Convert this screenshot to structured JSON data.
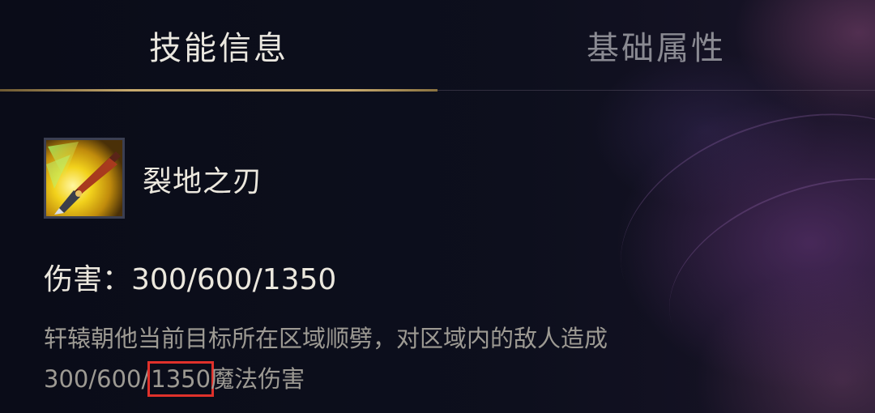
{
  "tabs": [
    {
      "label": "技能信息",
      "active": true
    },
    {
      "label": "基础属性",
      "active": false
    }
  ],
  "skill": {
    "icon": "blade-strike-icon",
    "name": "裂地之刃",
    "damage_label": "伤害：",
    "damage_values": "300/600/1350",
    "description_line1": "轩辕朝他当前目标所在区域顺劈，对区域内的敌人造成",
    "description_line2_prefix": "300/600/",
    "description_line2_highlight": "1350",
    "description_line2_suffix": "魔法伤害"
  },
  "colors": {
    "accent_gold": "#c8aa6e",
    "highlight_red": "#e0312b",
    "background": "#0b0d1a"
  }
}
